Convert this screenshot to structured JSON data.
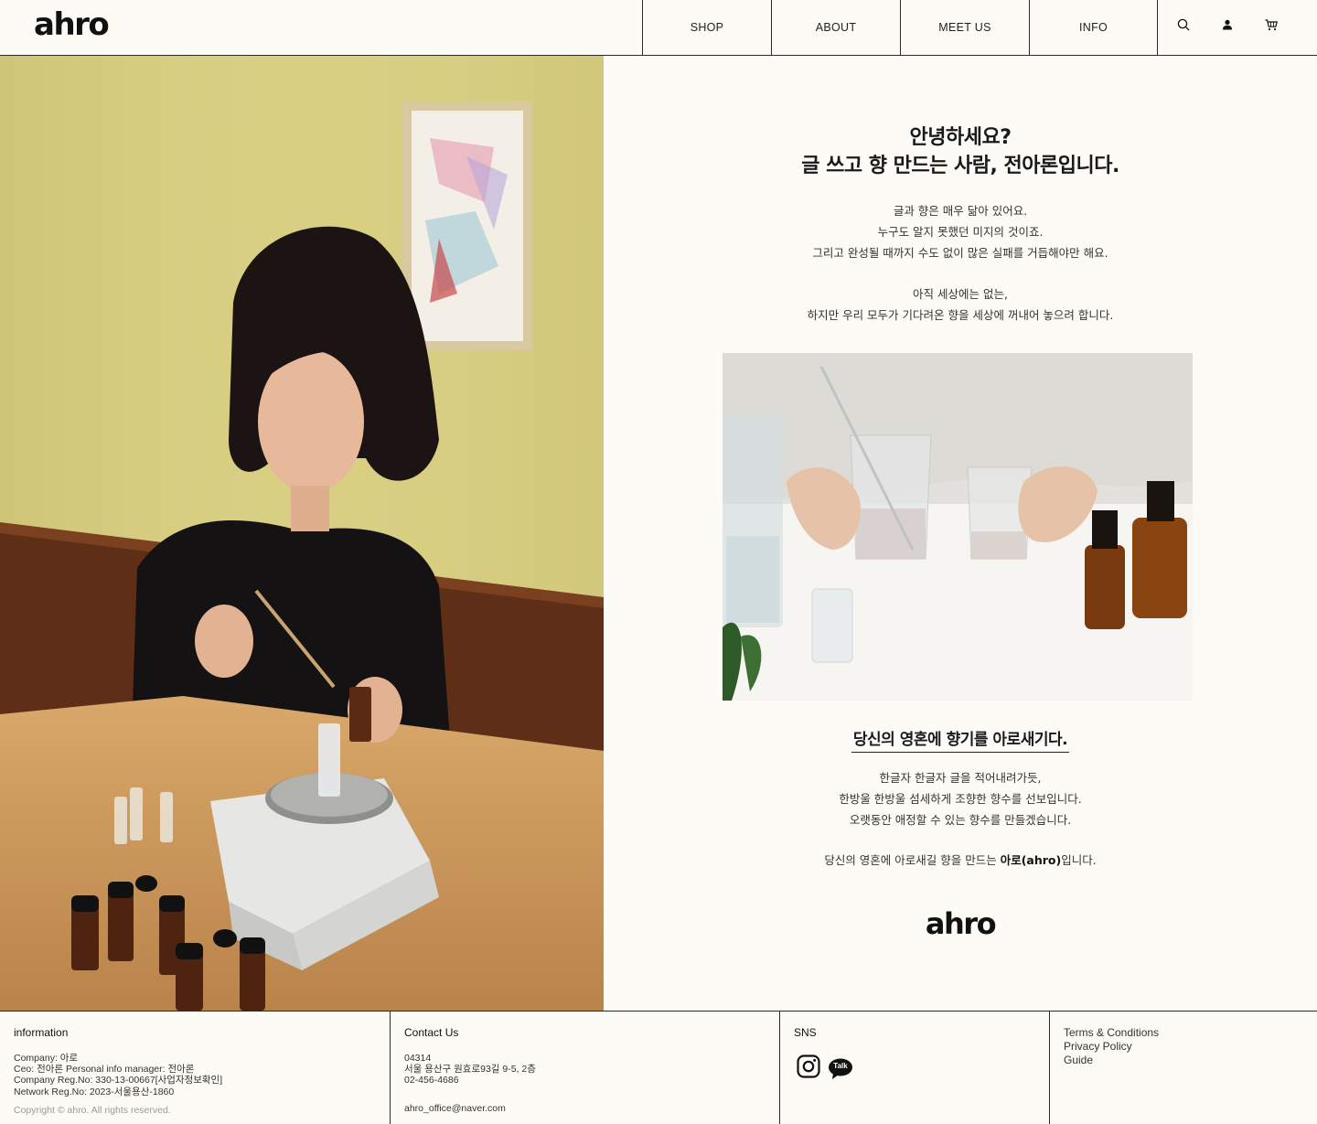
{
  "brand": {
    "logo": "ahro"
  },
  "nav": {
    "items": [
      {
        "label": "SHOP"
      },
      {
        "label": "ABOUT"
      },
      {
        "label": "MEET US"
      },
      {
        "label": "INFO"
      }
    ],
    "icons": [
      "search-icon",
      "user-icon",
      "cart-icon"
    ]
  },
  "intro": {
    "headline_line1": "안녕하세요?",
    "headline_line2": "글 쓰고 향 만드는 사람, 전아론입니다.",
    "para1": [
      "글과 향은 매우 닮아 있어요.",
      "누구도 알지 못했던 미지의 것이죠.",
      "그리고 완성될 때까지 수도 없이 많은 실패를 거듭해야만 해요."
    ],
    "para2": [
      "아직 세상에는 없는,",
      "하지만 우리 모두가 기다려온 향을 세상에 꺼내어 놓으려 합니다."
    ]
  },
  "mission": {
    "heading": "당신의 영혼에 향기를 아로새기다.",
    "para": [
      "한글자 한글자 글을 적어내려가듯,",
      "한방울 한방울 섬세하게 조향한 향수를 선보입니다.",
      "오랫동안 애정할 수 있는 향수를 만들겠습니다."
    ],
    "closing_prefix": "당신의 영혼에 아로새길 향을 만드는 ",
    "closing_brand": "아로(ahro)",
    "closing_suffix": "입니다.",
    "logo": "ahro"
  },
  "footer": {
    "information": {
      "title": "information",
      "lines": [
        "Company: 아로",
        "Ceo: 전아론 Personal info manager: 전아론",
        "Company Reg.No: 330-13-00667[사업자정보확인]",
        "Network Reg.No: 2023-서울용산-1860"
      ],
      "copyright": "Copyright © ahro. All rights reserved."
    },
    "contact": {
      "title": "Contact Us",
      "lines": [
        "04314",
        "서울 용산구 원효로93길 9-5, 2층",
        "02-456-4686"
      ],
      "email": "ahro_office@naver.com"
    },
    "sns": {
      "title": "SNS",
      "talk_label": "Talk"
    },
    "links": [
      "Terms & Conditions",
      "Privacy Policy",
      "Guide"
    ]
  },
  "colors": {
    "background": "#fdfbf5",
    "text": "#1c1c1c",
    "border": "#2a2a2a"
  }
}
